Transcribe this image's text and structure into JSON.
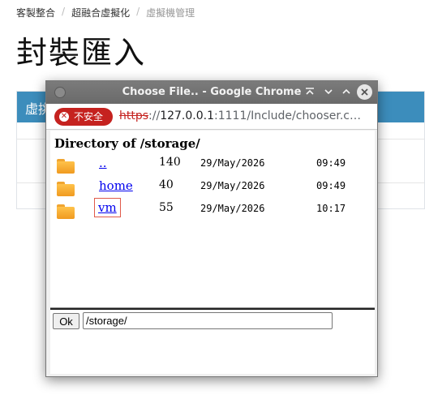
{
  "breadcrumb": [
    "客製整合",
    "超融合虛擬化",
    "虛擬機管理"
  ],
  "page_title": "封裝匯入",
  "bg_panel": {
    "header_text": "虛挑"
  },
  "window": {
    "title": "Choose File.. - Google Chrome",
    "buttons": {
      "shade": "⌅",
      "minimize": "⌄",
      "maximize": "⌃",
      "close": "✕"
    }
  },
  "address": {
    "security_label": "不安全",
    "scheme": "https",
    "separator": "://",
    "host": "127.0.0.1",
    "rest": ":1111/Include/chooser.cgi…"
  },
  "directory": {
    "title": "Directory of /storage/",
    "entries": [
      {
        "name": "..",
        "size": "140",
        "date": "29/May/2026",
        "time": "09:49",
        "icon": "folder-icon"
      },
      {
        "name": "home",
        "size": "40",
        "date": "29/May/2026",
        "time": "09:49",
        "icon": "folder-icon"
      },
      {
        "name": "vm",
        "size": "55",
        "date": "29/May/2026",
        "time": "10:17",
        "icon": "folder-icon",
        "selected": true
      }
    ]
  },
  "footer": {
    "ok_label": "Ok",
    "path_value": "/storage/"
  }
}
